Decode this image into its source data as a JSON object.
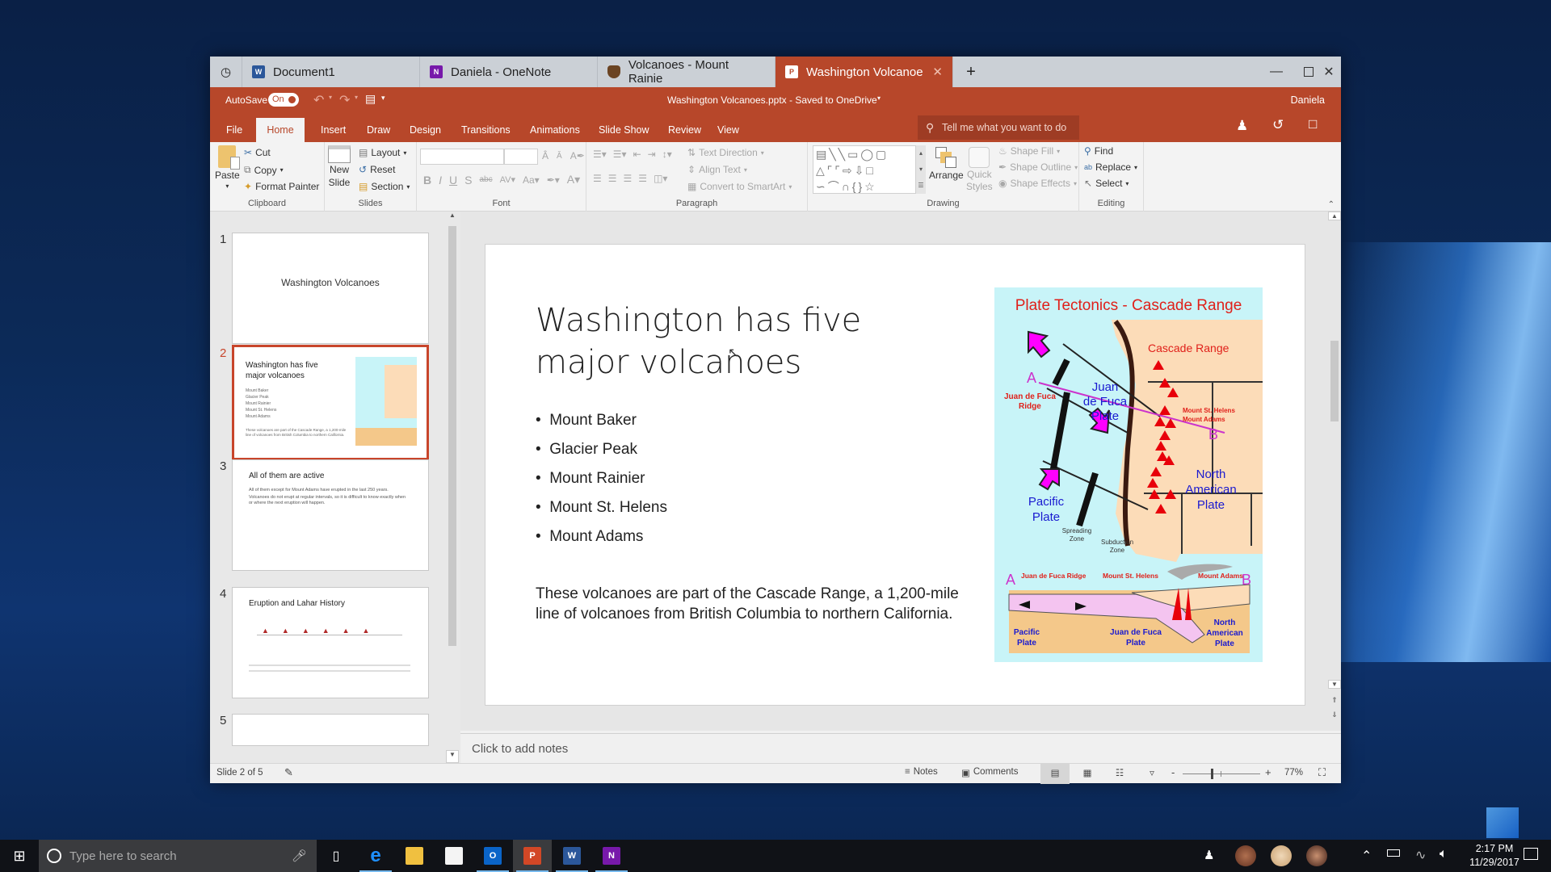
{
  "browser_tabs": [
    {
      "label": "Document1",
      "icon": "word-icon",
      "color": "#2b579a"
    },
    {
      "label": "Daniela - OneNote",
      "icon": "onenote-icon",
      "color": "#7719aa"
    },
    {
      "label": "Volcanoes - Mount Rainie",
      "icon": "nps-icon",
      "color": "#5a3a1e"
    },
    {
      "label": "Washington Volcanoe",
      "icon": "powerpoint-icon",
      "color": "#b7472a",
      "active": true
    }
  ],
  "title_bar": {
    "autosave_label": "AutoSave",
    "autosave_state": "On",
    "document_title": "Washington Volcanoes.pptx - Saved to OneDrive",
    "user": "Daniela"
  },
  "ribbon_tabs": [
    "File",
    "Home",
    "Insert",
    "Draw",
    "Design",
    "Transitions",
    "Animations",
    "Slide Show",
    "Review",
    "View"
  ],
  "active_ribbon_tab": "Home",
  "tell_me_placeholder": "Tell me what you want to do",
  "ribbon": {
    "clipboard": {
      "label": "Clipboard",
      "paste": "Paste",
      "cut": "Cut",
      "copy": "Copy",
      "format_painter": "Format Painter"
    },
    "slides": {
      "label": "Slides",
      "new_slide_1": "New",
      "new_slide_2": "Slide",
      "layout": "Layout",
      "reset": "Reset",
      "section": "Section"
    },
    "font": {
      "label": "Font"
    },
    "paragraph": {
      "label": "Paragraph",
      "text_direction": "Text Direction",
      "align_text": "Align Text",
      "convert_smartart": "Convert to SmartArt"
    },
    "drawing": {
      "label": "Drawing",
      "arrange": "Arrange",
      "quick_styles_1": "Quick",
      "quick_styles_2": "Styles",
      "shape_fill": "Shape Fill",
      "shape_outline": "Shape Outline",
      "shape_effects": "Shape Effects"
    },
    "editing": {
      "label": "Editing",
      "find": "Find",
      "replace": "Replace",
      "select": "Select"
    }
  },
  "slides": [
    {
      "number": "1",
      "title": "Washington Volcanoes"
    },
    {
      "number": "2",
      "title": "Washington has five major volcanoes",
      "selected": true
    },
    {
      "number": "3",
      "title": "All of them are active",
      "bullets": [
        "All of them except for Mount Adams have erupted in the last 250 years.",
        "Volcanoes do not erupt at regular intervals, so it is difficult to know exactly when or where the next eruption will happen."
      ]
    },
    {
      "number": "4",
      "title": "Eruption and Lahar History"
    },
    {
      "number": "5",
      "title": ""
    }
  ],
  "current_slide": {
    "title": "Washington has five major volcanoes",
    "bullets": [
      "Mount Baker",
      "Glacier Peak",
      "Mount Rainier",
      "Mount St. Helens",
      "Mount Adams"
    ],
    "body": "These volcanoes are part of the Cascade Range, a 1,200-mile line of volcanoes from British Columbia to northern California.",
    "figure": {
      "title": "Plate Tectonics - Cascade Range",
      "labels": {
        "cascade_range": "Cascade Range",
        "a": "A",
        "b": "B",
        "jdf_ridge_1": "Juan de Fuca",
        "jdf_ridge_2": "Ridge",
        "jdf_plate_1": "Juan",
        "jdf_plate_2": "de Fuca",
        "jdf_plate_3": "Plate",
        "st_helens": "Mount St. Helens",
        "adams": "Mount Adams",
        "na_1": "North",
        "na_2": "American",
        "na_3": "Plate",
        "pacific_1": "Pacific",
        "pacific_2": "Plate",
        "spreading_1": "Spreading",
        "spreading_2": "Zone",
        "subduction_1": "Subduction",
        "subduction_2": "Zone",
        "xs_ridge": "Juan de Fuca Ridge",
        "xs_helens": "Mount St. Helens",
        "xs_adams": "Mount Adams",
        "xs_pacific_1": "Pacific",
        "xs_pacific_2": "Plate",
        "xs_jdf_1": "Juan de Fuca",
        "xs_jdf_2": "Plate",
        "xs_na_1": "North",
        "xs_na_2": "American",
        "xs_na_3": "Plate"
      }
    }
  },
  "notes_placeholder": "Click to add notes",
  "status_bar": {
    "slide_indicator": "Slide 2 of 5",
    "notes": "Notes",
    "comments": "Comments",
    "zoom_out": "-",
    "zoom_in": "+",
    "zoom_level": "77%",
    "zoom_fraction": 0.77
  },
  "taskbar": {
    "search_placeholder": "Type here to search",
    "time": "2:17 PM",
    "date": "11/29/2017"
  },
  "colors": {
    "accent": "#b7472a",
    "ribbon_bg": "#f3f3f3",
    "figure_bg": "#c8f4f8",
    "land": "#fcdcb8"
  }
}
